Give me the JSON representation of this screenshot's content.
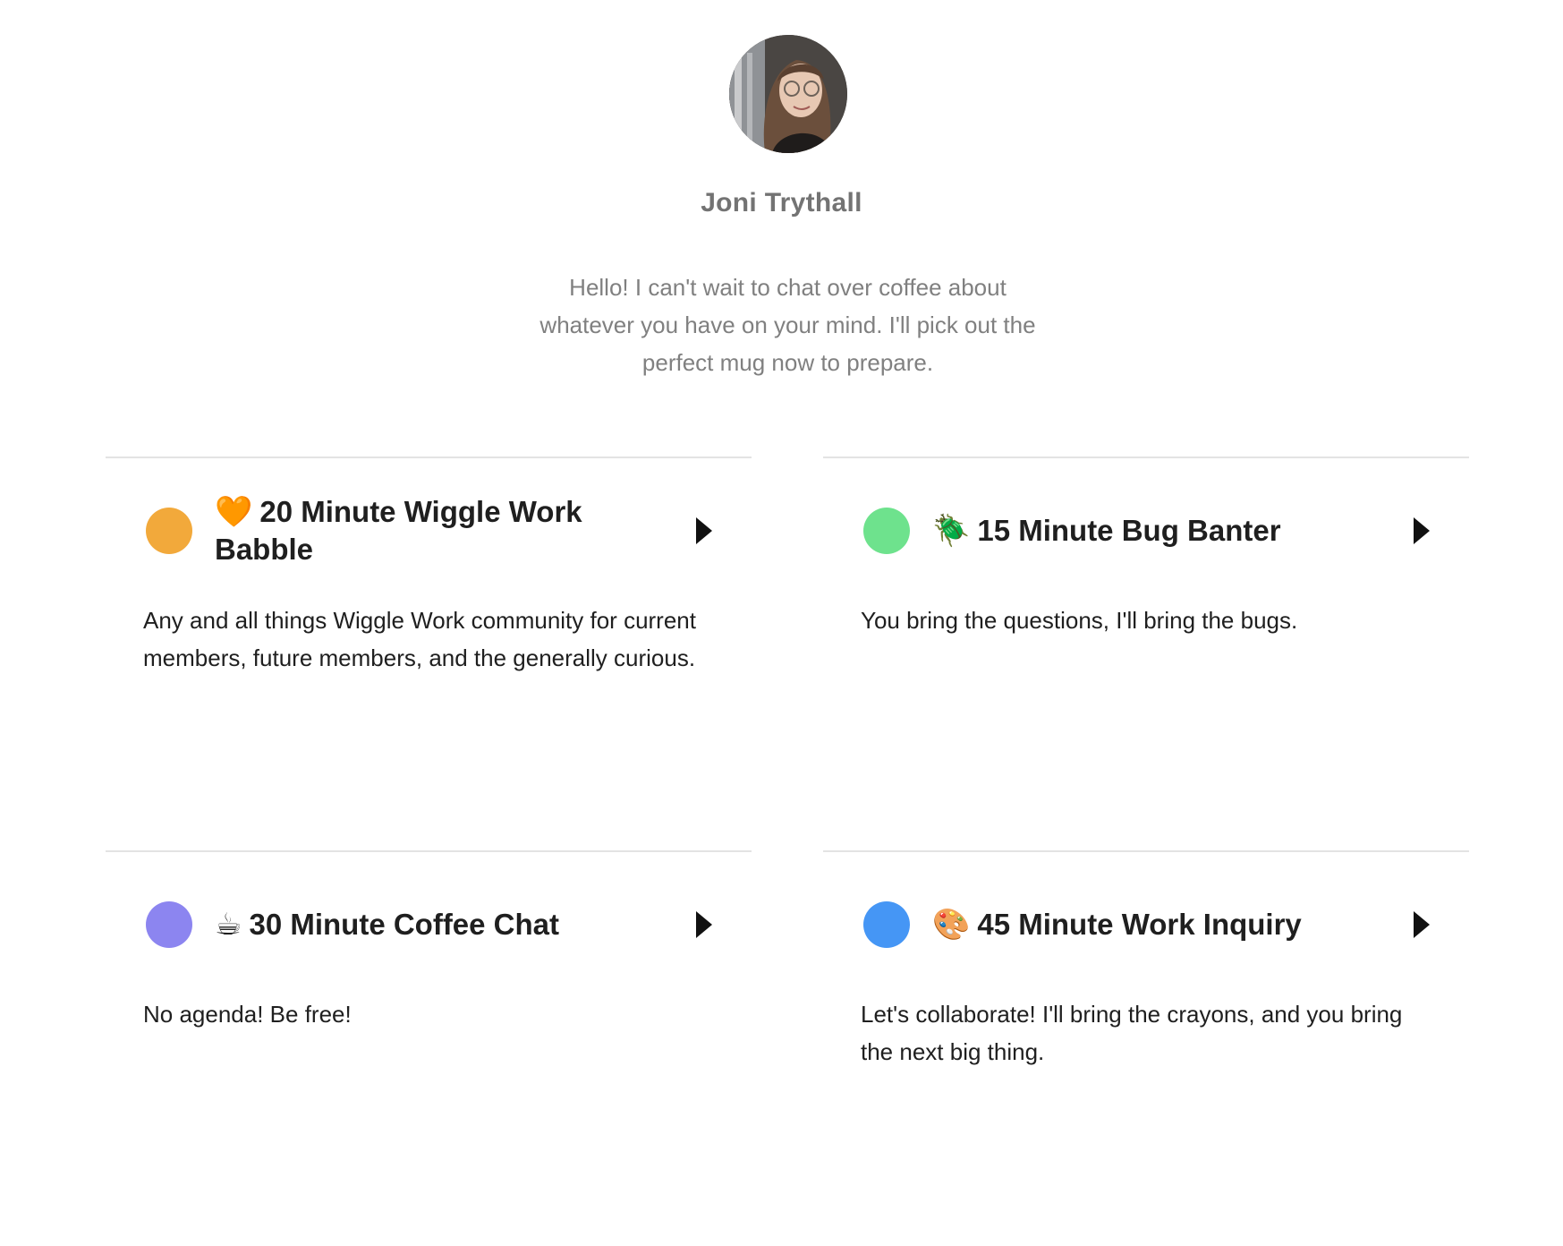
{
  "host": {
    "name": "Joni Trythall",
    "avatar_alt": "avatar",
    "welcome_message": "Hello! I can't wait to chat over coffee about whatever you have on your mind. I'll pick out the perfect mug now to prepare."
  },
  "event_types": [
    {
      "emoji": "🧡",
      "title": "20 Minute Wiggle Work Babble",
      "description": "Any and all things Wiggle Work community for current members, future members, and the generally curious.",
      "color": "#f2a93b"
    },
    {
      "emoji": "🪲",
      "title": "15 Minute Bug Banter",
      "description": "You bring the questions, I'll bring the bugs.",
      "color": "#6ee28d"
    },
    {
      "emoji": "☕",
      "title": "30 Minute Coffee Chat",
      "description": "No agenda! Be free!",
      "color": "#8c85f0"
    },
    {
      "emoji": "🎨",
      "title": "45 Minute Work Inquiry",
      "description": "Let's collaborate! I'll bring the crayons, and you bring the next big thing.",
      "color": "#4596f5"
    }
  ]
}
